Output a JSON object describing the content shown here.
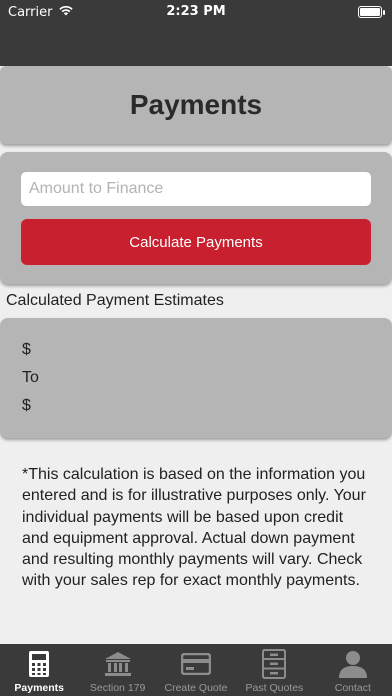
{
  "status_bar": {
    "carrier": "Carrier",
    "time": "2:23 PM"
  },
  "page": {
    "title": "Payments"
  },
  "form": {
    "amount_placeholder": "Amount to Finance",
    "amount_value": "",
    "calculate_label": "Calculate Payments"
  },
  "results": {
    "section_label": "Calculated Payment Estimates",
    "line1": "$",
    "line2": "To",
    "line3": "$"
  },
  "disclaimer": "*This calculation is based on the information you entered and is for illustrative purposes only. Your individual payments will be based upon credit and equipment approval. Actual down payment and resulting monthly payments will vary. Check with your sales rep for exact monthly payments.",
  "tabs": [
    {
      "label": "Payments",
      "icon": "calculator-icon",
      "active": true
    },
    {
      "label": "Section 179",
      "icon": "bank-icon",
      "active": false
    },
    {
      "label": "Create Quote",
      "icon": "credit-card-icon",
      "active": false
    },
    {
      "label": "Past Quotes",
      "icon": "filing-cabinet-icon",
      "active": false
    },
    {
      "label": "Contact",
      "icon": "person-icon",
      "active": false
    }
  ],
  "colors": {
    "accent": "#c8202f",
    "bar": "#3a3a3a",
    "card": "#b5b5b5",
    "background": "#efefef"
  }
}
